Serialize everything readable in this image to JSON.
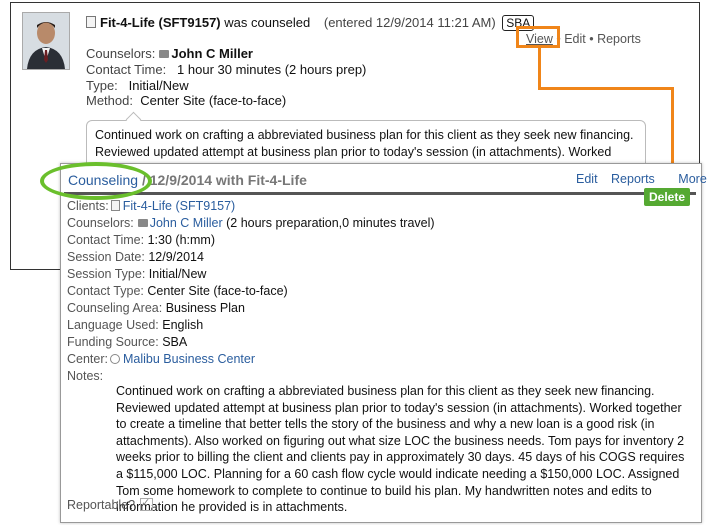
{
  "back_card": {
    "client_name": "Fit-4-Life (SFT9157)",
    "action": "was counseled",
    "entered": "(entered 12/9/2014 11:21 AM)",
    "badge": "SBA",
    "actions": {
      "view": "View",
      "sep1": " • ",
      "edit": "Edit",
      "sep2": " • ",
      "reports": "Reports"
    },
    "counselors_label": "Counselors:",
    "counselor": "John C Miller",
    "contact_time_label": "Contact Time:",
    "contact_time": "1 hour 30 minutes (2 hours prep)",
    "type_label": "Type:",
    "type": "Initial/New",
    "method_label": "Method:",
    "method": "Center Site (face-to-face)",
    "notes": "Continued work on crafting a abbreviated business plan for this client as they seek new financing. Reviewed updated attempt at business plan prior to today's session (in attachments). Worked together"
  },
  "front_panel": {
    "crumb": "Counseling",
    "title_rest": " / 12/9/2014 with Fit-4-Life",
    "actions": {
      "edit": "Edit",
      "reports": "Reports",
      "more": "More"
    },
    "delete_label": "Delete",
    "fields": {
      "clients_label": "Clients:",
      "clients": "Fit-4-Life (SFT9157)",
      "counselors_label": "Counselors:",
      "counselor": "John C Miller",
      "counselor_extra": " (2 hours preparation,0 minutes travel)",
      "contact_time_label": "Contact Time:",
      "contact_time": "1:30 (h:mm)",
      "session_date_label": "Session Date:",
      "session_date": "12/9/2014",
      "session_type_label": "Session Type:",
      "session_type": "Initial/New",
      "contact_type_label": "Contact Type:",
      "contact_type": "Center Site (face-to-face)",
      "counseling_area_label": "Counseling Area:",
      "counseling_area": "Business Plan",
      "language_label": "Language Used:",
      "language": "English",
      "funding_label": "Funding Source:",
      "funding": "SBA",
      "center_label": "Center:",
      "center": "Malibu Business Center",
      "notes_label": "Notes:"
    },
    "notes": "Continued work on crafting a abbreviated business plan for this client as they seek new financing. Reviewed updated attempt at business plan prior to today's session (in attachments). Worked together to create a timeline that better tells the story of the business and why a new loan is a good risk (in attachments). Also worked on figuring out what size LOC the business needs. Tom pays for inventory 2 weeks prior to billing the client and clients pay in approximately 30 days. 45 days of his COGS requires a $115,000 LOC. Planning for a 60 cash flow cycle would indicate needing a $150,000 LOC. Assigned Tom some homework to complete to continue to build his plan. My handwritten notes and edits to information he provided is in attachments.",
    "reportable_label": "Reportable?",
    "reportable_checked": true
  },
  "colors": {
    "highlight_orange": "#f08519",
    "highlight_green": "#6abf2c",
    "link_blue": "#2a5d9e",
    "delete_green": "#55a932"
  }
}
